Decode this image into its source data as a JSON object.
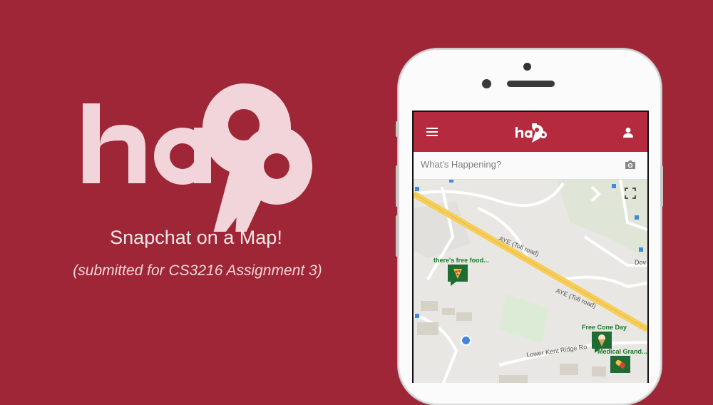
{
  "brand": {
    "logo": "happ",
    "tagline": "Snapchat on a Map!",
    "subline": "(submitted for CS3216 Assignment 3)"
  },
  "app": {
    "logo": "happ",
    "search": {
      "placeholder": "What's Happening?"
    },
    "icons": {
      "menu": "menu-icon",
      "user": "user-icon",
      "camera": "camera-icon",
      "fullscreen": "fullscreen-icon"
    }
  },
  "map": {
    "road_1": "AYE (Toll road)",
    "road_2": "AYE (Toll road)",
    "road_3": "Lower Kent Ridge Ro",
    "road_4": "Dov",
    "pins": [
      {
        "label": "there's free food...",
        "icon": "pizza-icon"
      },
      {
        "label": "Free Cone Day",
        "icon": "ice-cream-icon"
      },
      {
        "label": "Medical Grand...",
        "icon": "pill-icon"
      }
    ]
  },
  "colors": {
    "background": "#9f2636",
    "appbar": "#b62a3e",
    "pin": "#1e6b34",
    "logo": "#f1d5da"
  }
}
